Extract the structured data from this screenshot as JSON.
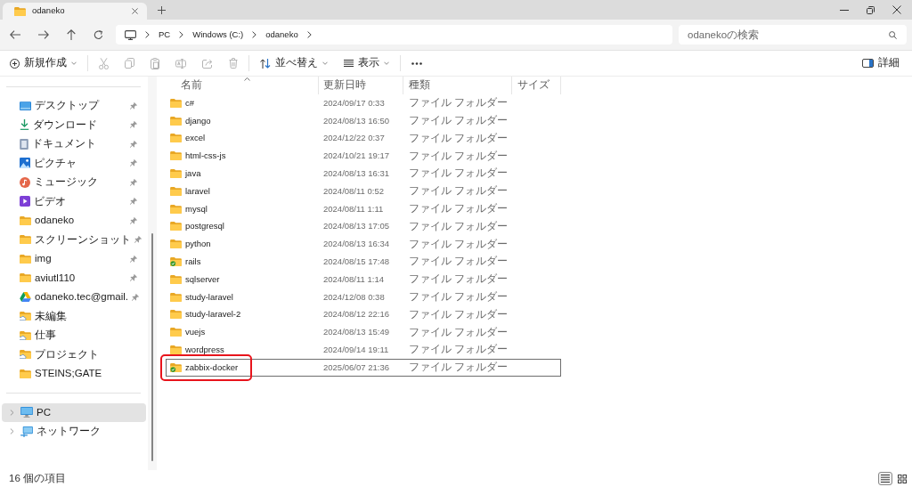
{
  "window": {
    "tabs": [
      {
        "label": "odaneko",
        "selected": true
      }
    ]
  },
  "navigation": {
    "breadcrumb": [
      "PC",
      "Windows (C:)",
      "odaneko"
    ],
    "search": {
      "placeholder": "odanekoの検索"
    }
  },
  "toolbar": {
    "groups": [
      {
        "items": [
          {
            "kind": "new",
            "label": "新規作成",
            "disabled": false
          }
        ]
      },
      {
        "items": [
          {
            "kind": "cut",
            "disabled": true
          },
          {
            "kind": "copy",
            "disabled": true
          },
          {
            "kind": "paste",
            "disabled": true
          },
          {
            "kind": "rename",
            "disabled": true
          },
          {
            "kind": "share",
            "disabled": true
          },
          {
            "kind": "delete",
            "disabled": true
          }
        ]
      },
      {
        "items": [
          {
            "kind": "sort",
            "label": "並べ替え",
            "disabled": false
          },
          {
            "kind": "view",
            "label": "表示",
            "disabled": false
          }
        ]
      },
      {
        "items": [
          {
            "kind": "more",
            "disabled": false
          }
        ]
      }
    ],
    "details_button": {
      "label": "詳細"
    }
  },
  "sidebar": {
    "quick_access": [
      {
        "kind": "desktop",
        "label": "デスクトップ",
        "pinned": true,
        "selected": false
      },
      {
        "kind": "downloads",
        "label": "ダウンロード",
        "pinned": true,
        "selected": false
      },
      {
        "kind": "documents",
        "label": "ドキュメント",
        "pinned": true,
        "selected": false
      },
      {
        "kind": "pictures",
        "label": "ピクチャ",
        "pinned": true,
        "selected": false
      },
      {
        "kind": "music",
        "label": "ミュージック",
        "pinned": true,
        "selected": false
      },
      {
        "kind": "videos",
        "label": "ビデオ",
        "pinned": true,
        "selected": false
      },
      {
        "kind": "folder",
        "label": "odaneko",
        "pinned": true,
        "selected": false
      },
      {
        "kind": "folder",
        "label": "スクリーンショット",
        "pinned": true,
        "selected": false
      },
      {
        "kind": "folder",
        "label": "img",
        "pinned": true,
        "selected": false
      },
      {
        "kind": "folder",
        "label": "aviutl110",
        "pinned": true,
        "selected": false
      },
      {
        "kind": "cloud-drive",
        "label": "odaneko.tec@gmail.",
        "pinned": true,
        "selected": false
      },
      {
        "kind": "cloud-folder",
        "label": "未編集",
        "pinned": false,
        "selected": false
      },
      {
        "kind": "cloud-folder",
        "label": "仕事",
        "pinned": false,
        "selected": false
      },
      {
        "kind": "cloud-folder",
        "label": "プロジェクト",
        "pinned": false,
        "selected": false
      },
      {
        "kind": "folder",
        "label": "STEINS;GATE",
        "pinned": false,
        "selected": false
      }
    ],
    "locations": [
      {
        "kind": "pc",
        "label": "PC",
        "selected": true,
        "expanded": false
      },
      {
        "kind": "network",
        "label": "ネットワーク",
        "selected": false,
        "expanded": false
      }
    ]
  },
  "file_list": {
    "columns": [
      {
        "label": "名前",
        "sorted": true
      },
      {
        "label": "更新日時",
        "sorted": false
      },
      {
        "label": "種類",
        "sorted": false
      },
      {
        "label": "サイズ",
        "sorted": false
      }
    ],
    "rows": [
      {
        "kind": "folder",
        "name": "c#",
        "modified": "2024/09/17 0:33",
        "type": "ファイル フォルダー",
        "focused": false,
        "highlighted": false
      },
      {
        "kind": "folder",
        "name": "django",
        "modified": "2024/08/13 16:50",
        "type": "ファイル フォルダー",
        "focused": false,
        "highlighted": false
      },
      {
        "kind": "folder",
        "name": "excel",
        "modified": "2024/12/22 0:37",
        "type": "ファイル フォルダー",
        "focused": false,
        "highlighted": false
      },
      {
        "kind": "folder",
        "name": "html-css-js",
        "modified": "2024/10/21 19:17",
        "type": "ファイル フォルダー",
        "focused": false,
        "highlighted": false
      },
      {
        "kind": "folder",
        "name": "java",
        "modified": "2024/08/13 16:31",
        "type": "ファイル フォルダー",
        "focused": false,
        "highlighted": false
      },
      {
        "kind": "folder",
        "name": "laravel",
        "modified": "2024/08/11 0:52",
        "type": "ファイル フォルダー",
        "focused": false,
        "highlighted": false
      },
      {
        "kind": "folder",
        "name": "mysql",
        "modified": "2024/08/11 1:11",
        "type": "ファイル フォルダー",
        "focused": false,
        "highlighted": false
      },
      {
        "kind": "folder",
        "name": "postgresql",
        "modified": "2024/08/13 17:05",
        "type": "ファイル フォルダー",
        "focused": false,
        "highlighted": false
      },
      {
        "kind": "folder",
        "name": "python",
        "modified": "2024/08/13 16:34",
        "type": "ファイル フォルダー",
        "focused": false,
        "highlighted": false
      },
      {
        "kind": "checked-folder",
        "name": "rails",
        "modified": "2024/08/15 17:48",
        "type": "ファイル フォルダー",
        "focused": false,
        "highlighted": false
      },
      {
        "kind": "folder",
        "name": "sqlserver",
        "modified": "2024/08/11 1:14",
        "type": "ファイル フォルダー",
        "focused": false,
        "highlighted": false
      },
      {
        "kind": "folder",
        "name": "study-laravel",
        "modified": "2024/12/08 0:38",
        "type": "ファイル フォルダー",
        "focused": false,
        "highlighted": false
      },
      {
        "kind": "folder",
        "name": "study-laravel-2",
        "modified": "2024/08/12 22:16",
        "type": "ファイル フォルダー",
        "focused": false,
        "highlighted": false
      },
      {
        "kind": "folder",
        "name": "vuejs",
        "modified": "2024/08/13 15:49",
        "type": "ファイル フォルダー",
        "focused": false,
        "highlighted": false
      },
      {
        "kind": "folder",
        "name": "wordpress",
        "modified": "2024/09/14 19:11",
        "type": "ファイル フォルダー",
        "focused": false,
        "highlighted": false
      },
      {
        "kind": "checked-folder",
        "name": "zabbix-docker",
        "modified": "2025/06/07 21:36",
        "type": "ファイル フォルダー",
        "focused": true,
        "highlighted": true
      }
    ]
  },
  "status_bar": {
    "item_count": "16 個の項目",
    "views": [
      {
        "kind": "details",
        "selected": true
      },
      {
        "kind": "tiles",
        "selected": false
      }
    ]
  }
}
